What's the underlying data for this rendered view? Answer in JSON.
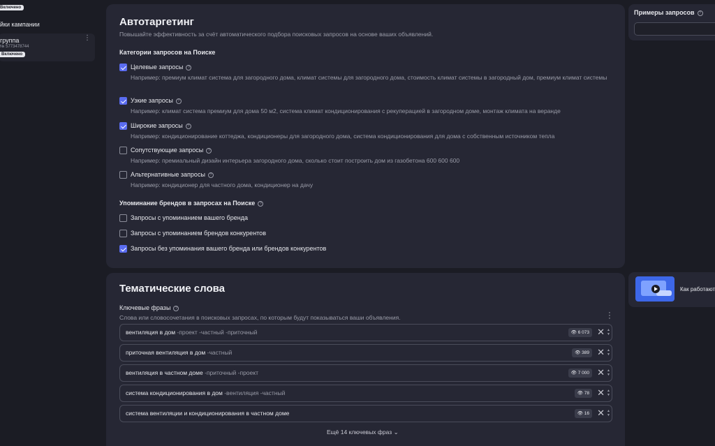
{
  "left": {
    "status_badge": "Включено",
    "settings_label": "йки кампании",
    "group": {
      "name": "группа",
      "id": "№ 5773478744",
      "badge": "Включено"
    }
  },
  "autotargeting": {
    "title": "Автотаргетинг",
    "subtitle": "Повышайте эффективность за счёт автоматического подбора поисковых запросов на основе ваших объявлений.",
    "categories_title": "Категории запросов на Поиске",
    "categories": [
      {
        "label": "Целевые запросы",
        "checked": true,
        "example": "Например: премиум климат система для загородного дома, климат системы для загородного дома, стоимость климат системы в загородный дом, премиум климат системы"
      },
      {
        "label": "Узкие запросы",
        "checked": true,
        "example": "Например: климат система премиум для дома 50 м2, система климат кондиционирования с рекуперацией в загородном доме, монтаж климата на веранде"
      },
      {
        "label": "Широкие запросы",
        "checked": true,
        "example": "Например: кондиционирование коттеджа, кондиционеры для загородного дома, система кондиционирования для дома с собственным источником тепла"
      },
      {
        "label": "Сопутствующие запросы",
        "checked": false,
        "example": "Например: премиальный дизайн интерьера загородного дома, сколько стоит построить дом из газобетона 600 600 600"
      },
      {
        "label": "Альтернативные запросы",
        "checked": false,
        "example": "Например: кондиционер для частного дома, кондиционер на дачу"
      }
    ],
    "brands_title": "Упоминание брендов в запросах на Поиске",
    "brands": [
      {
        "label": "Запросы с упоминанием вашего бренда",
        "checked": false
      },
      {
        "label": "Запросы с упоминанием брендов конкурентов",
        "checked": false
      },
      {
        "label": "Запросы без упоминания вашего бренда или брендов конкурентов",
        "checked": true
      }
    ]
  },
  "keywords": {
    "title": "Тематические слова",
    "section_label": "Ключевые фразы",
    "description": "Слова или словосочетания в поисковых запросах, по которым будут показываться ваши объявления.",
    "phrases": [
      {
        "text": "вентиляция в дом",
        "negatives": " -проект -частный -приточный",
        "count": "6 073"
      },
      {
        "text": "приточная вентиляция в дом",
        "negatives": " -частный",
        "count": "389"
      },
      {
        "text": "вентиляция в частном доме",
        "negatives": " -приточный -проект",
        "count": "7 000"
      },
      {
        "text": "система кондиционирования в дом",
        "negatives": " -вентиляция -частный",
        "count": "78"
      },
      {
        "text": "система вентиляции и кондиционирования в частном доме",
        "negatives": "",
        "count": "16"
      }
    ],
    "more_label": "Ещё 14 ключевых фраз"
  },
  "right": {
    "examples_title": "Примеры запросов",
    "promo_text": "Как работают"
  }
}
